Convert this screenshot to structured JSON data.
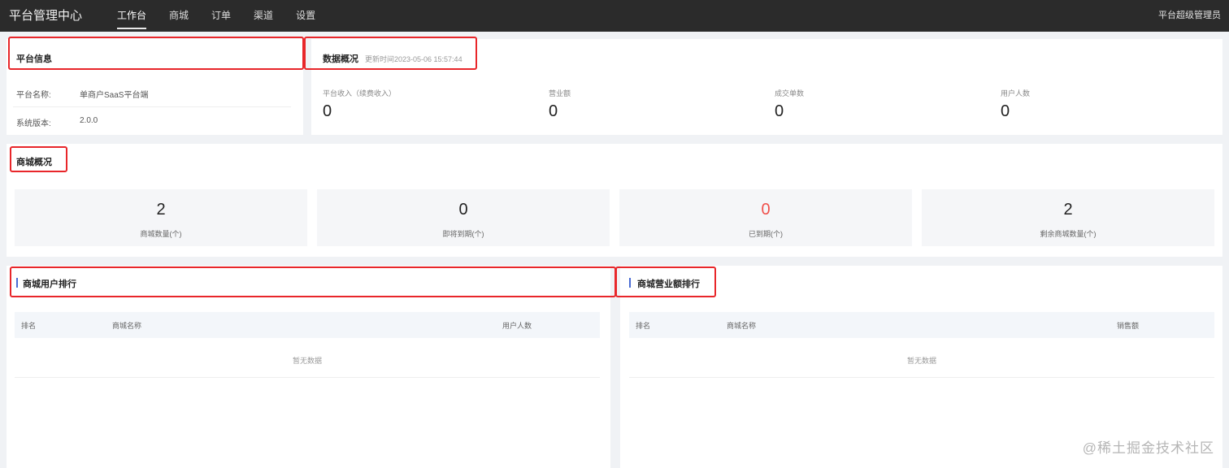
{
  "header": {
    "logo": "平台管理中心",
    "nav": [
      "工作台",
      "商城",
      "订单",
      "渠道",
      "设置"
    ],
    "user": "平台超级管理员"
  },
  "platform_info": {
    "title": "平台信息",
    "rows": [
      {
        "label": "平台名称:",
        "value": "单商户SaaS平台端"
      },
      {
        "label": "系统版本:",
        "value": "2.0.0"
      }
    ]
  },
  "data_overview": {
    "title": "数据概况",
    "update_time": "更新时间2023-05-06 15:57:44",
    "stats": [
      {
        "label": "平台收入（续费收入）",
        "value": "0"
      },
      {
        "label": "营业额",
        "value": "0"
      },
      {
        "label": "成交单数",
        "value": "0"
      },
      {
        "label": "用户人数",
        "value": "0"
      }
    ]
  },
  "mall_overview": {
    "title": "商城概况",
    "cards": [
      {
        "value": "2",
        "label": "商城数量(个)"
      },
      {
        "value": "0",
        "label": "即将到期(个)"
      },
      {
        "value": "0",
        "label": "已到期(个)"
      },
      {
        "value": "2",
        "label": "剩余商城数量(个)"
      }
    ]
  },
  "user_ranking": {
    "title": "商城用户排行",
    "columns": [
      "排名",
      "商城名称",
      "用户人数"
    ],
    "empty": "暂无数据"
  },
  "sales_ranking": {
    "title": "商城营业额排行",
    "columns": [
      "排名",
      "商城名称",
      "销售额"
    ],
    "empty": "暂无数据"
  },
  "watermark": "@稀土掘金技术社区",
  "colors": {
    "topbar": "#2b2b2b",
    "highlight_box": "#e8262a",
    "expired_value": "#f0504b",
    "ranking_accent": "#4a6cd4"
  }
}
